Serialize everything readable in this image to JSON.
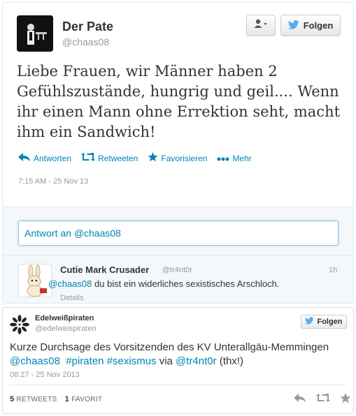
{
  "main_tweet": {
    "name": "Der Pate",
    "handle": "@chaas08",
    "follow_label": "Folgen",
    "text": "Liebe Frauen, wir Männer haben 2 Gefühlszustände, hungrig und geil.... Wenn ihr einen Mann ohne Errektion seht, macht ihm ein Sandwich!",
    "actions": {
      "reply": "Antworten",
      "retweet": "Retweeten",
      "favorite": "Favorisieren",
      "more": "Mehr"
    },
    "timestamp": "7:15 AM - 25 Nov 13",
    "reply_placeholder": "Antwort an @chaas08"
  },
  "reply_tweet": {
    "name": "Cutie Mark Crusader",
    "handle": "@tr4nt0r",
    "age": "1h",
    "mention": "@chaas08",
    "text": " du bist ein widerliches sexistisches Arschloch.",
    "details": "Details"
  },
  "embedded_tweet": {
    "name": "Edelweißpiraten",
    "handle": "@edelweispiraten",
    "follow_label": "Folgen",
    "text_plain_1": "Kurze Durchsage des Vorsitzenden des KV Unterallgäu-Memmingen ",
    "mention_1": "@chaas08",
    "hashtag_1": "#piraten",
    "hashtag_2": "#sexismus",
    "text_via": " via ",
    "mention_2": "@tr4nt0r",
    "text_end": " (thx!)",
    "timestamp": "08:27 - 25 Nov 2013",
    "retweets_count": "5",
    "retweets_label": "RETWEETS",
    "favorites_count": "1",
    "favorites_label": "FAVORIT"
  },
  "colors": {
    "link": "#0084b4",
    "twitter_bird": "#55acee",
    "muted": "#999999"
  },
  "icons": [
    "user-icon",
    "twitter-bird-icon",
    "reply-icon",
    "retweet-icon",
    "star-icon",
    "more-icon"
  ]
}
